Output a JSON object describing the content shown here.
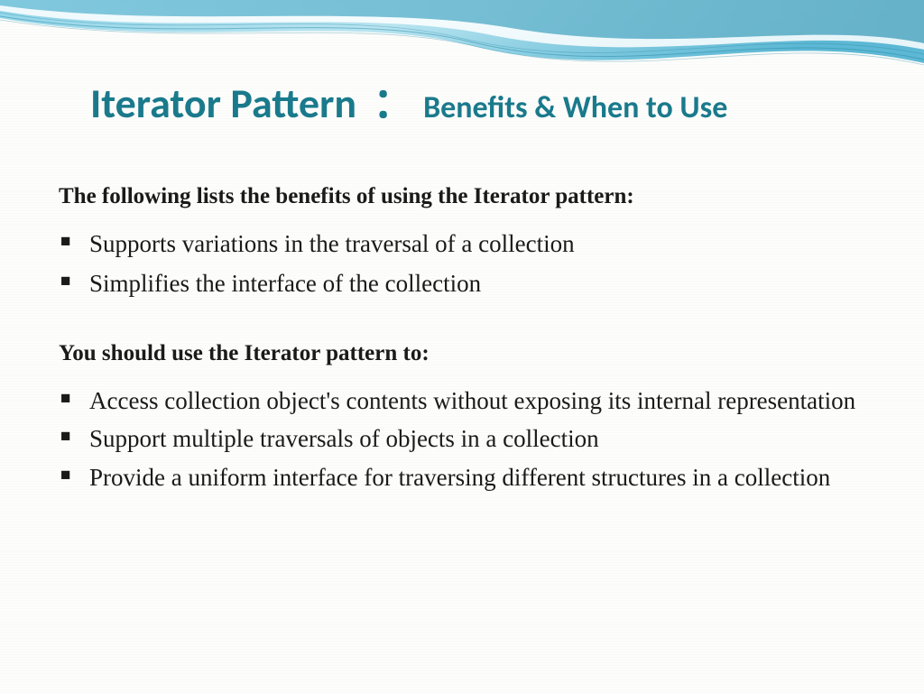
{
  "title": {
    "main": "Iterator Pattern",
    "colon": "：",
    "sub": "Benefits & When to Use"
  },
  "section1": {
    "heading": "The following lists the benefits of using the Iterator pattern:",
    "bullets": [
      "Supports variations in the traversal of a collection",
      "Simplifies the interface of the collection"
    ]
  },
  "section2": {
    "heading": "You should use the Iterator pattern to:",
    "bullets": [
      "Access collection object's contents without exposing its internal  representation",
      "Support multiple traversals of objects in a collection",
      "Provide a uniform interface for traversing different structures in a  collection"
    ]
  }
}
